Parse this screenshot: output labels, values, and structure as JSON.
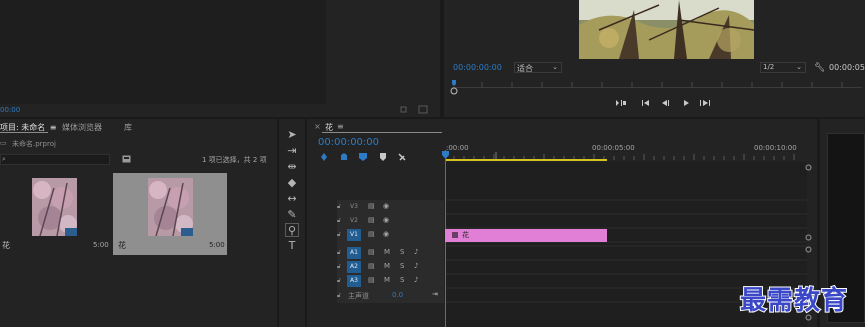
{
  "source_monitor": {
    "timecode_fragment": "00:00"
  },
  "program_monitor": {
    "timecode": "00:00:00:00",
    "fit": "适合",
    "resolution": "1/2",
    "duration": "00:00:05:"
  },
  "project_panel": {
    "tabs": [
      "项目: 未命名",
      "媒体浏览器",
      "库"
    ],
    "menu_icon": "≡",
    "path": "未命名.prproj",
    "selection_status": "1 项已选择，共 2 项",
    "items": [
      {
        "name": "花",
        "duration": "5:00"
      },
      {
        "name": "花",
        "duration": "5:00"
      }
    ]
  },
  "timeline": {
    "sequence_tab": "花",
    "timecode": "00:00:00:00",
    "ruler_labels": [
      ":00:00",
      "00:00:05:00",
      "00:00:10:00"
    ],
    "video_tracks": [
      "V3",
      "V2",
      "V1"
    ],
    "audio_tracks": [
      "A1",
      "A2",
      "A3"
    ],
    "audio_buttons": {
      "mute": "M",
      "solo": "S"
    },
    "clip_name": "花",
    "master_label": "主声道",
    "master_value": "0.0"
  },
  "watermark": "最需教育"
}
